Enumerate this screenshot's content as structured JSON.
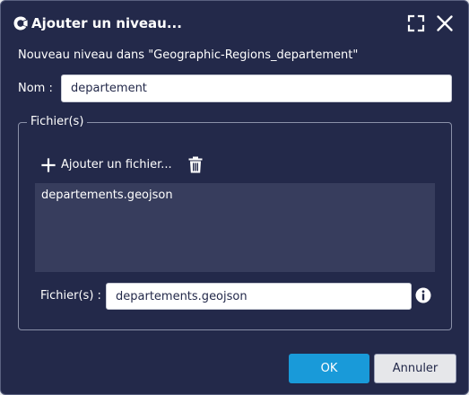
{
  "dialog": {
    "title": "Ajouter un niveau...",
    "subtitle": "Nouveau niveau dans \"Geographic-Regions_departement\"",
    "icons": {
      "app": "app-logo-icon",
      "maximize": "maximize-icon",
      "close": "close-icon"
    }
  },
  "name_field": {
    "label": "Nom :",
    "value": "departement"
  },
  "files_group": {
    "legend": "Fichier(s)",
    "add_label": "Ajouter un fichier...",
    "add_icon": "plus-icon",
    "delete_icon": "trash-icon",
    "list": [
      {
        "name": "departements.geojson"
      }
    ],
    "field_label": "Fichier(s) :",
    "field_value": "departements.geojson",
    "info_icon": "info-icon"
  },
  "buttons": {
    "ok": "OK",
    "cancel": "Annuler"
  },
  "colors": {
    "background": "#23294a",
    "list_background": "#373d5d",
    "primary": "#199ad9",
    "text": "#ffffff"
  }
}
